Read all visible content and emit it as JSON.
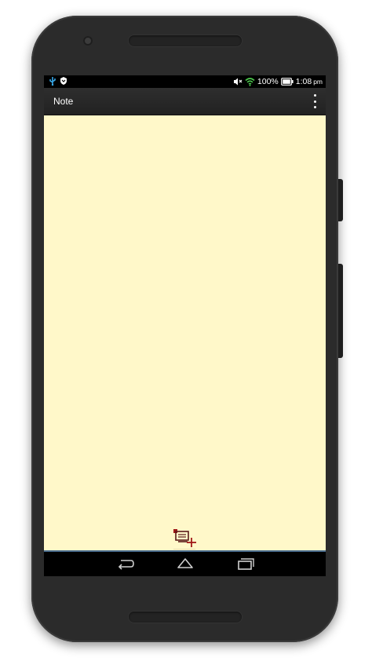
{
  "status_bar": {
    "battery_percent": "100%",
    "time": "1:08",
    "time_suffix": "pm",
    "icons": [
      "usb-debug-icon",
      "shield-icon",
      "mute-icon",
      "wifi-icon",
      "battery-icon"
    ]
  },
  "app_bar": {
    "title": "Note",
    "menu_icon": "overflow-menu-icon"
  },
  "content": {
    "background_color": "#fff8c9",
    "add_note_icon": "add-note-icon"
  },
  "nav_bar": {
    "buttons": [
      "back-icon",
      "home-icon",
      "recents-icon"
    ]
  },
  "colors": {
    "accent_line": "#4a6c8c",
    "add_icon_red": "#a01818",
    "add_icon_dark": "#5a1a1a"
  }
}
